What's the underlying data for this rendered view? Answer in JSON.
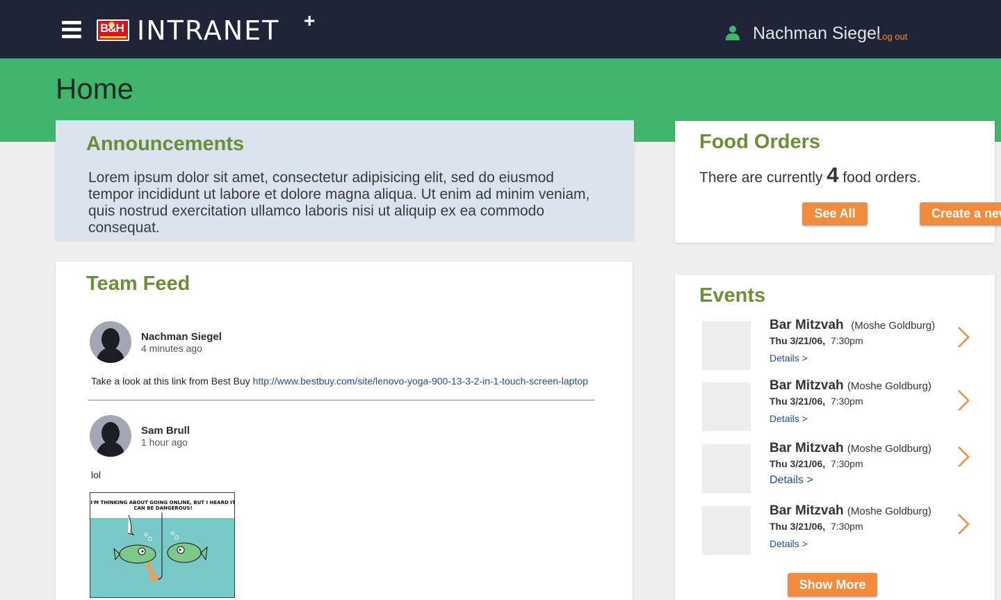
{
  "header": {
    "brand": "INTRANET",
    "brand_plus": "+",
    "logo_text": "B&H",
    "user_name": "Nachman Siegel",
    "logout_label": "Log out"
  },
  "page": {
    "title": "Home"
  },
  "announcements": {
    "title": "Announcements",
    "body": "Lorem ipsum dolor sit amet, consectetur adipisicing elit, sed do eiusmod tempor incididunt ut labore et dolore magna aliqua. Ut enim ad minim veniam, quis nostrud exercitation ullamco laboris nisi ut aliquip ex ea commodo consequat."
  },
  "team_feed": {
    "title": "Team Feed",
    "posts": [
      {
        "author": "Nachman Siegel",
        "time": "4 minutes ago",
        "text": "Take a look at this link from Best Buy ",
        "link": "http://www.bestbuy.com/site/lenovo-yoga-900-13-3-2-in-1-touch-screen-laptop"
      },
      {
        "author": "Sam Brull",
        "time": "1 hour ago",
        "text": "lol",
        "image_caption": "I'M THINKING ABOUT GOING ONLINE, BUT I HEARD IT CAN BE DANGEROUS!"
      }
    ]
  },
  "food_orders": {
    "title": "Food Orders",
    "text_before": "There are currently ",
    "count": "4",
    "text_after": " food orders.",
    "see_all_label": "See All",
    "create_label": "Create a new"
  },
  "events": {
    "title": "Events",
    "items": [
      {
        "name": "Bar Mitzvah",
        "host": "(Moshe Goldburg)",
        "day": "Thu 3/21/06,",
        "time": "7:30pm",
        "details": "Details >"
      },
      {
        "name": "Bar Mitzvah",
        "host": "(Moshe Goldburg)",
        "day": "Thu 3/21/06,",
        "time": "7:30pm",
        "details": "Details >"
      },
      {
        "name": "Bar Mitzvah",
        "host": "(Moshe Goldburg)",
        "day": "Thu 3/21/06,",
        "time": "7:30pm",
        "details": "Details >"
      },
      {
        "name": "Bar Mitzvah",
        "host": "(Moshe Goldburg)",
        "day": "Thu 3/21/06,",
        "time": "7:30pm",
        "details": "Details >"
      }
    ],
    "show_more_label": "Show More"
  },
  "colors": {
    "topbar": "#1f2436",
    "green_band": "#40b56b",
    "card_title": "#6a8f36",
    "accent_orange": "#f28b3c",
    "link_blue": "#1f4d93"
  }
}
